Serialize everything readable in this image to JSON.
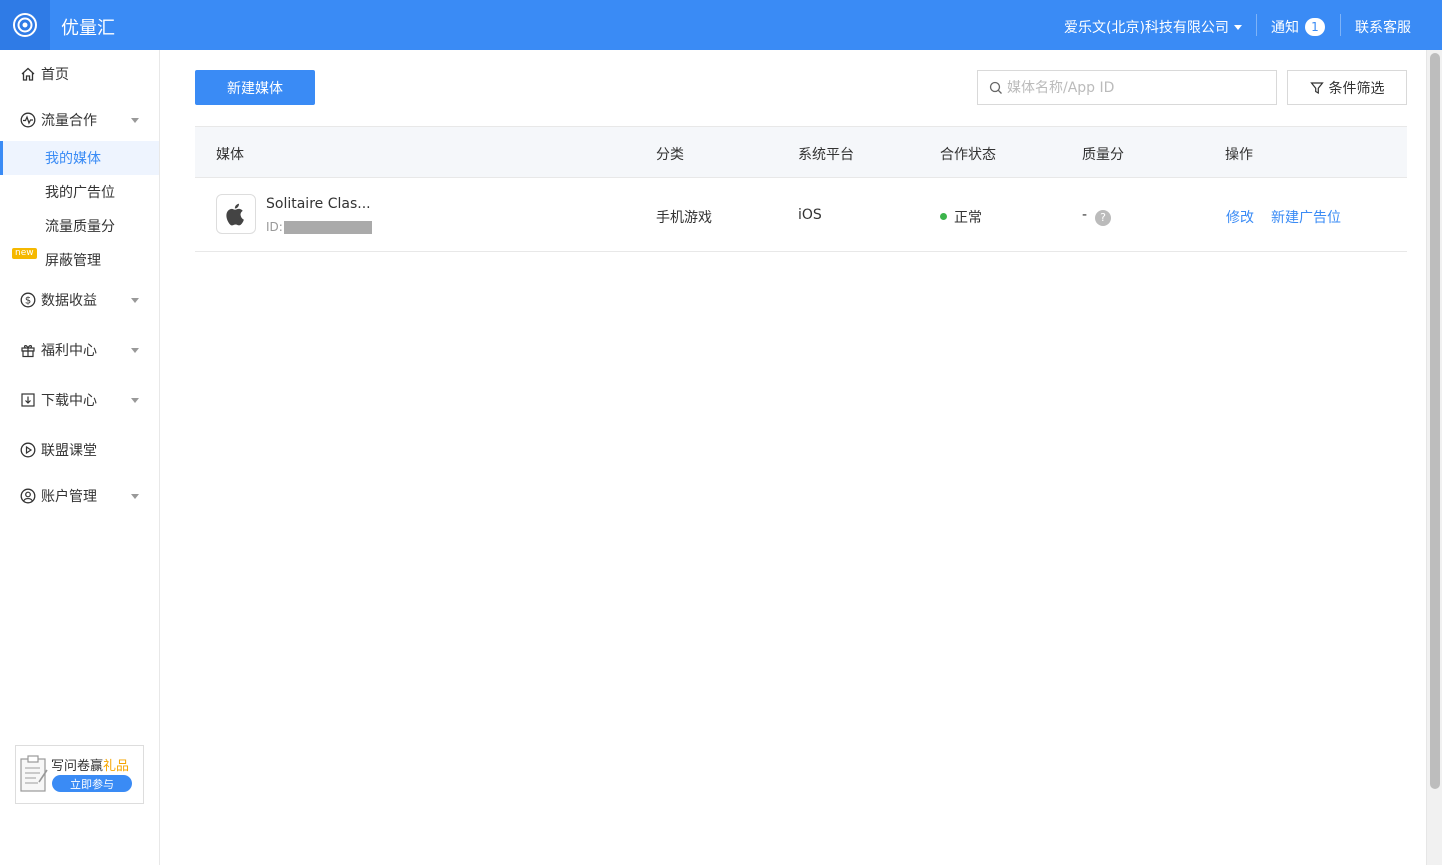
{
  "header": {
    "brand": "优量汇",
    "company": "爱乐文(北京)科技有限公司",
    "notice_label": "通知",
    "notice_count": "1",
    "service_label": "联系客服"
  },
  "sidebar": {
    "home": "首页",
    "traffic": "流量合作",
    "traffic_sub": [
      "我的媒体",
      "我的广告位",
      "流量质量分"
    ],
    "new_tag": "new",
    "block": "屏蔽管理",
    "data": "数据收益",
    "welfare": "福利中心",
    "download": "下载中心",
    "course": "联盟课堂",
    "account": "账户管理",
    "promo_text": "写问卷赢",
    "promo_highlight": "礼品",
    "promo_button": "立即参与"
  },
  "toolbar": {
    "new_media": "新建媒体",
    "search_placeholder": "媒体名称/App ID",
    "filter": "条件筛选"
  },
  "table": {
    "headers": [
      "媒体",
      "分类",
      "系统平台",
      "合作状态",
      "质量分",
      "操作"
    ],
    "rows": [
      {
        "name": "Solitaire Clas...",
        "id_label": "ID:",
        "category": "手机游戏",
        "platform": "iOS",
        "status": "正常",
        "quality": "-",
        "actions": [
          "修改",
          "新建广告位"
        ]
      }
    ]
  },
  "colors": {
    "primary": "#3a8bf5",
    "status_ok": "#3cb44b",
    "promo_highlight": "#f5a500"
  },
  "icons": {
    "logo": "radar-logo-icon",
    "home": "home-icon",
    "traffic": "pulse-icon",
    "data": "dollar-circle-icon",
    "welfare": "gift-icon",
    "download": "download-icon",
    "course": "play-circle-icon",
    "account": "user-circle-icon",
    "search": "search-icon",
    "filter": "funnel-icon",
    "app": "apple-icon",
    "quality_help": "question-circle-icon"
  }
}
